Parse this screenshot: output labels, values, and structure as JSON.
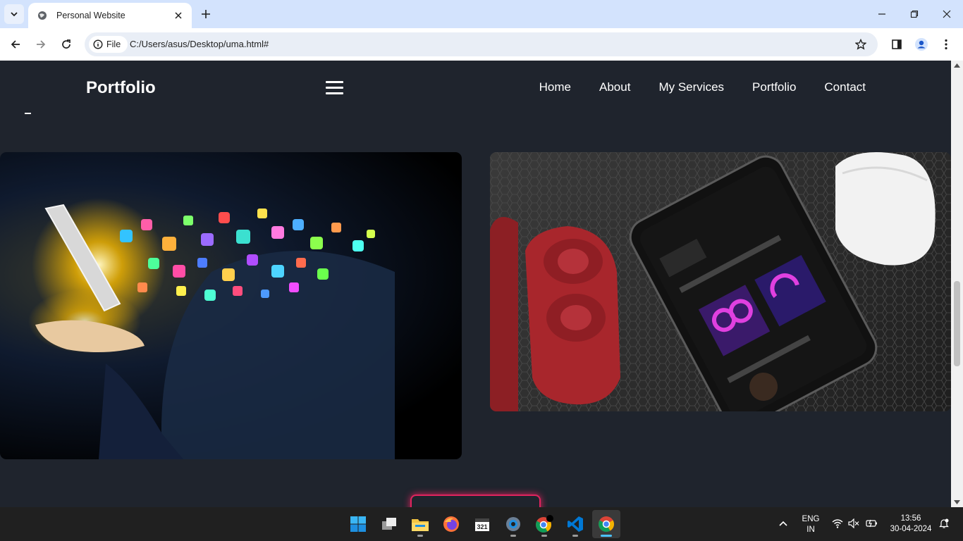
{
  "browser": {
    "tab_title": "Personal Website",
    "security_chip_label": "File",
    "url": "C:/Users/asus/Desktop/uma.html#"
  },
  "site": {
    "logo": "Portfolio",
    "nav": [
      "Home",
      "About",
      "My Services",
      "Portfolio",
      "Contact"
    ]
  },
  "images": [
    {
      "alt_semantic": "hand-with-app-icons-image"
    },
    {
      "alt_semantic": "phone-and-earbuds-music-app-image"
    }
  ],
  "taskbar": {
    "apps": [
      "start",
      "task-view",
      "file-explorer",
      "firefox",
      "calendar",
      "settings",
      "chrome-profile",
      "vscode",
      "chrome"
    ],
    "language_line1": "ENG",
    "language_line2": "IN",
    "time": "13:56",
    "date": "30-04-2024"
  },
  "colors": {
    "page_bg": "#1f242d",
    "accent": "#e0245e",
    "tab_strip": "#d3e3fd"
  }
}
